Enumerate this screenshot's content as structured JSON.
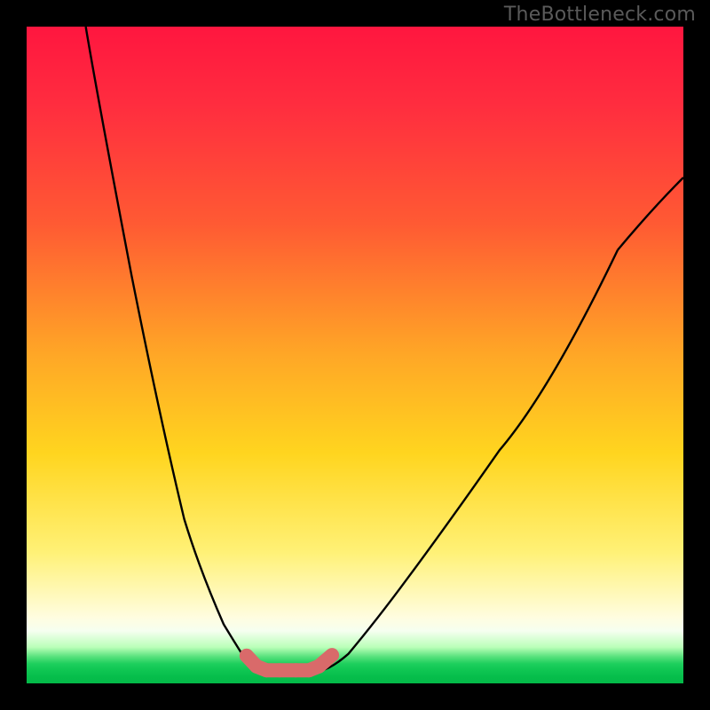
{
  "watermark": "TheBottleneck.com",
  "chart_data": {
    "type": "line",
    "title": "",
    "xlabel": "",
    "ylabel": "",
    "xlim": [
      0,
      100
    ],
    "ylim": [
      0,
      100
    ],
    "grid": false,
    "legend": null,
    "series": [
      {
        "name": "curve-left",
        "x": [
          9,
          12,
          16,
          20,
          24,
          27,
          30,
          33,
          34,
          35.5,
          37
        ],
        "y": [
          100,
          82,
          62,
          44,
          28,
          17.5,
          9,
          3.5,
          2.6,
          2.0,
          2.0
        ]
      },
      {
        "name": "curve-right",
        "x": [
          45,
          47,
          49,
          53,
          58,
          64,
          72,
          80,
          90,
          100
        ],
        "y": [
          2.0,
          2.8,
          4.5,
          9,
          16,
          24.5,
          35.5,
          45,
          56,
          66
        ]
      },
      {
        "name": "marker-band",
        "x": [
          33.5,
          35,
          36.5,
          38.5,
          41,
          43,
          44.5,
          46.5
        ],
        "y": [
          4.2,
          2.6,
          2.0,
          2.0,
          2.0,
          2.0,
          2.6,
          4.3
        ]
      }
    ],
    "annotations": [],
    "colors": {
      "gradient_top": "#ff163f",
      "gradient_mid1": "#ffa726",
      "gradient_mid2": "#ffee58",
      "gradient_bottom": "#06be4b",
      "curve": "#000000",
      "marker": "#d96a6a",
      "frame": "#000000"
    }
  }
}
